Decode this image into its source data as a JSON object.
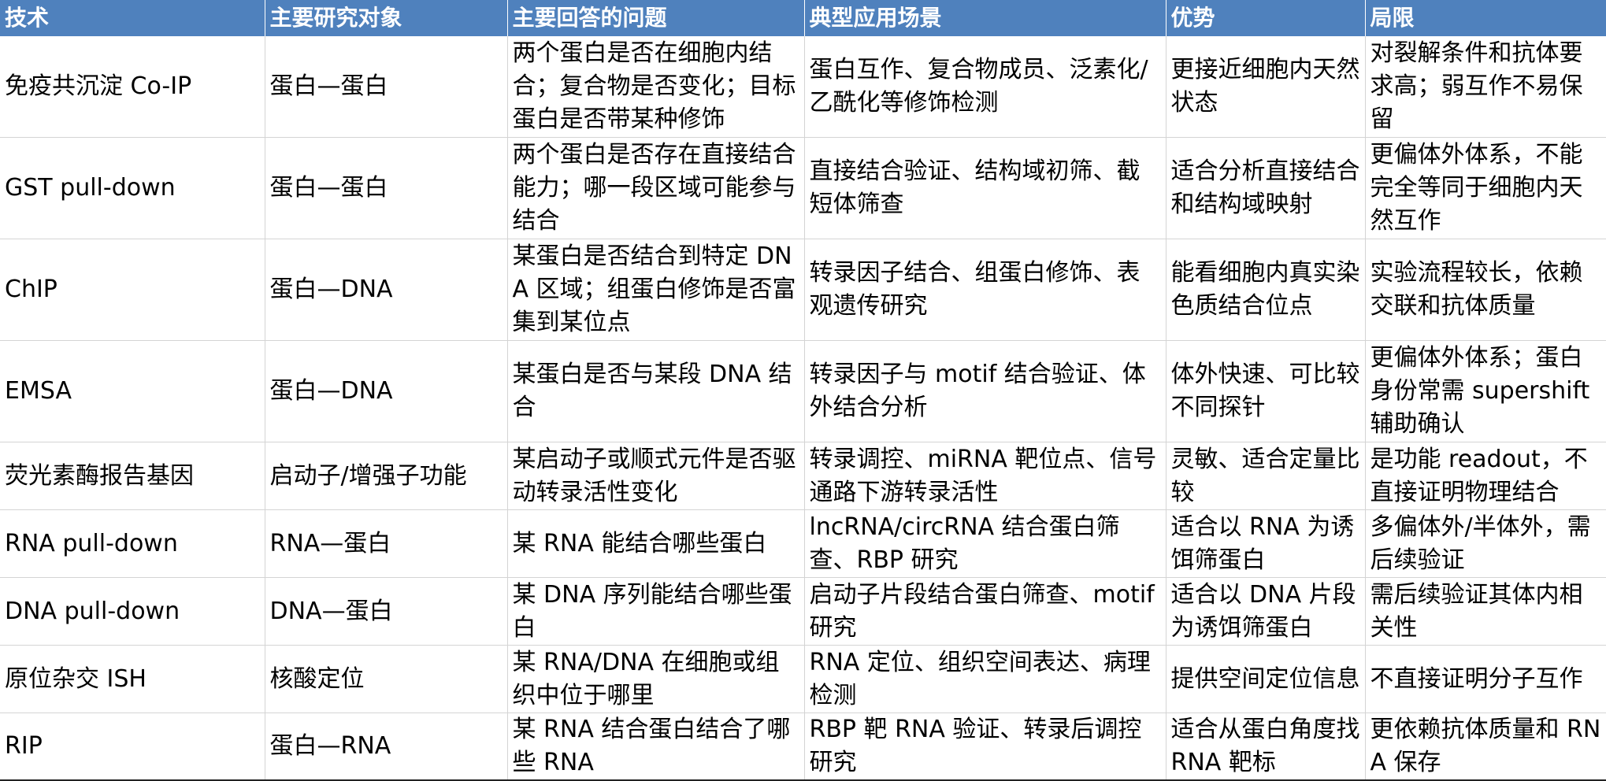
{
  "table": {
    "headers": [
      "技术",
      "主要研究对象",
      "主要回答的问题",
      "典型应用场景",
      "优势",
      "局限"
    ],
    "rows": [
      [
        "免疫共沉淀 Co-IP",
        "蛋白—蛋白",
        "两个蛋白是否在细胞内结合；复合物是否变化；目标蛋白是否带某种修饰",
        "蛋白互作、复合物成员、泛素化/乙酰化等修饰检测",
        "更接近细胞内天然状态",
        "对裂解条件和抗体要求高；弱互作不易保留"
      ],
      [
        "GST pull-down",
        "蛋白—蛋白",
        "两个蛋白是否存在直接结合能力；哪一段区域可能参与结合",
        "直接结合验证、结构域初筛、截短体筛查",
        "适合分析直接结合和结构域映射",
        "更偏体外体系，不能完全等同于细胞内天然互作"
      ],
      [
        "ChIP",
        "蛋白—DNA",
        "某蛋白是否结合到特定 DNA 区域；组蛋白修饰是否富集到某位点",
        "转录因子结合、组蛋白修饰、表观遗传研究",
        "能看细胞内真实染色质结合位点",
        "实验流程较长，依赖交联和抗体质量"
      ],
      [
        "EMSA",
        "蛋白—DNA",
        "某蛋白是否与某段 DNA 结合",
        "转录因子与 motif 结合验证、体外结合分析",
        "体外快速、可比较不同探针",
        "更偏体外体系；蛋白身份常需 supershift 辅助确认"
      ],
      [
        "荧光素酶报告基因",
        "启动子/增强子功能",
        "某启动子或顺式元件是否驱动转录活性变化",
        "转录调控、miRNA 靶位点、信号通路下游转录活性",
        "灵敏、适合定量比较",
        "是功能 readout，不直接证明物理结合"
      ],
      [
        "RNA pull-down",
        "RNA—蛋白",
        "某 RNA 能结合哪些蛋白",
        "lncRNA/circRNA 结合蛋白筛查、RBP 研究",
        "适合以 RNA 为诱饵筛蛋白",
        "多偏体外/半体外，需后续验证"
      ],
      [
        "DNA pull-down",
        "DNA—蛋白",
        "某 DNA 序列能结合哪些蛋白",
        "启动子片段结合蛋白筛查、motif 研究",
        "适合以 DNA 片段为诱饵筛蛋白",
        "需后续验证其体内相关性"
      ],
      [
        "原位杂交 ISH",
        "核酸定位",
        "某 RNA/DNA 在细胞或组织中位于哪里",
        "RNA 定位、组织空间表达、病理检测",
        "提供空间定位信息",
        "不直接证明分子互作"
      ],
      [
        "RIP",
        "蛋白—RNA",
        "某 RNA 结合蛋白结合了哪些 RNA",
        "RBP 靶 RNA 验证、转录后调控研究",
        "适合从蛋白角度找 RNA 靶标",
        "更依赖抗体质量和 RNA 保存"
      ]
    ]
  }
}
